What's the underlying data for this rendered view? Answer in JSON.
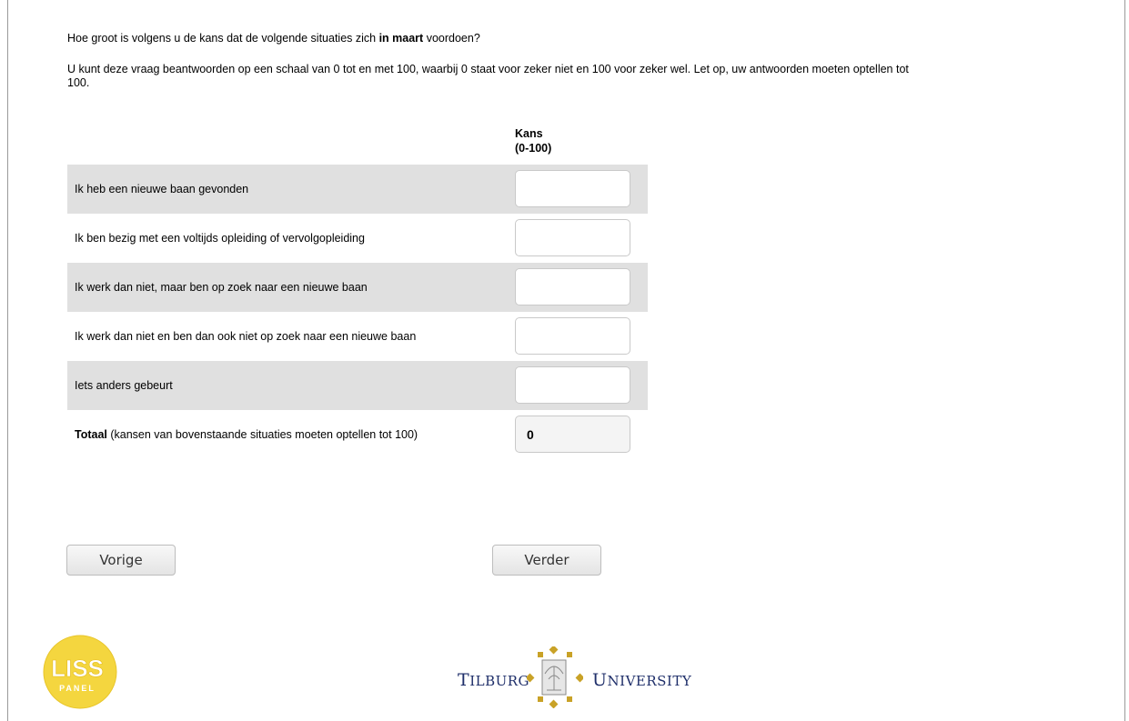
{
  "question": {
    "line1_prefix": "Hoe groot is volgens u de kans dat de volgende situaties zich ",
    "line1_bold": "in maart",
    "line1_suffix": " voordoen?",
    "instructions": "U kunt deze vraag beantwoorden op een schaal van 0 tot en met 100, waarbij 0 staat voor zeker niet en 100 voor zeker wel. Let op, uw antwoorden moeten optellen tot 100."
  },
  "table": {
    "column_header_line1": "Kans",
    "column_header_line2": "(0-100)",
    "rows": [
      {
        "label": "Ik heb een nieuwe baan gevonden",
        "value": ""
      },
      {
        "label": "Ik ben bezig met een voltijds opleiding of vervolgopleiding",
        "value": ""
      },
      {
        "label": "Ik werk dan niet, maar ben op zoek naar een nieuwe baan",
        "value": ""
      },
      {
        "label": "Ik werk dan niet en ben dan ook niet op zoek naar een nieuwe baan",
        "value": ""
      },
      {
        "label": "Iets anders gebeurt",
        "value": ""
      }
    ],
    "total": {
      "label_bold": "Totaal",
      "label_rest": " (kansen van bovenstaande situaties moeten optellen tot 100)",
      "value": "0"
    }
  },
  "nav": {
    "back_label": "Vorige",
    "next_label": "Verder"
  },
  "footer": {
    "liss_logo_text": "LISS",
    "liss_logo_sub": "PANEL",
    "tilburg_left": "ILBURG",
    "tilburg_left_cap": "T",
    "tilburg_right": "NIVERSITY",
    "tilburg_right_cap": "U"
  },
  "colors": {
    "row_shade": "#e0e0e0",
    "liss_yellow": "#f4d63f",
    "tilburg_gold": "#c9a227",
    "tilburg_blue": "#1f2f6a"
  }
}
